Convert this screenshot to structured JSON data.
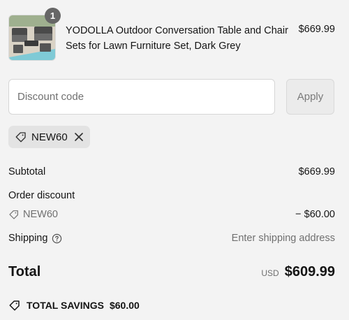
{
  "product": {
    "image_icon": "patio-furniture-thumbnail",
    "quantity": "1",
    "name": "YODOLLA Outdoor Conversation Table and Chair Sets for Lawn Furniture Set, Dark Grey",
    "price": "$669.99"
  },
  "discount": {
    "input_value": "",
    "placeholder": "Discount code",
    "apply_label": "Apply",
    "applied_code": "NEW60",
    "tag_icon": "tag-icon",
    "remove_icon": "close-icon"
  },
  "summary": {
    "subtotal_label": "Subtotal",
    "subtotal_value": "$669.99",
    "order_discount_label": "Order discount",
    "order_discount_code": "NEW60",
    "order_discount_value": "− $60.00",
    "shipping_label": "Shipping",
    "shipping_value": "Enter shipping address",
    "shipping_help_icon": "question-circle-icon"
  },
  "total": {
    "label": "Total",
    "currency": "USD",
    "amount": "$609.99"
  },
  "savings": {
    "label": "TOTAL SAVINGS",
    "amount": "$60.00",
    "icon": "tag-icon"
  }
}
